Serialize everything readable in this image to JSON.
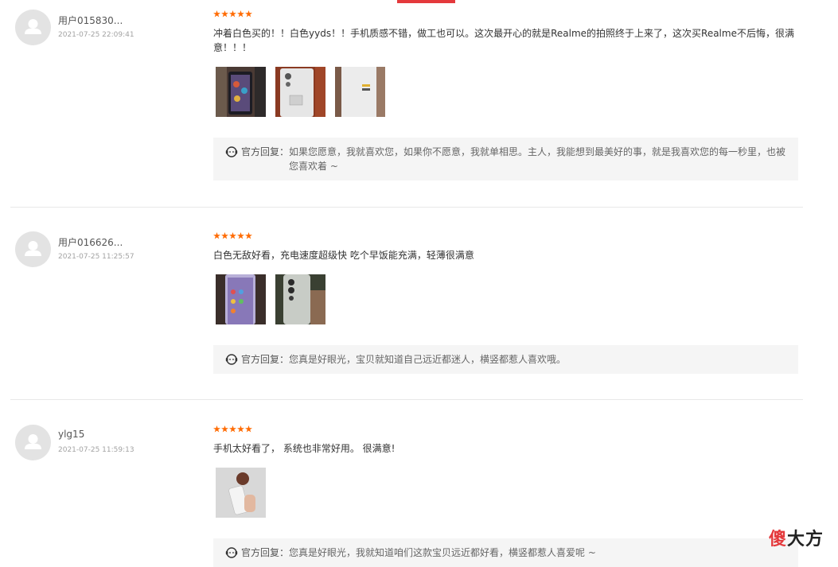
{
  "reviews": [
    {
      "user_name": "用户015830...",
      "date": "2021-07-25 22:09:41",
      "rating": 5,
      "content": "冲着白色买的！！白色yyds！！手机质感不错，做工也可以。这次最开心的就是Realme的拍照终于上来了，这次买Realme不后悔，很满意！！！",
      "reply_label": "官方回复：",
      "reply_text": "如果您愿意，我就喜欢您，如果你不愿意，我就单相思。主人，我能想到最美好的事，就是我喜欢您的每一秒里，也被您喜欢着 ~"
    },
    {
      "user_name": "用户016626...",
      "date": "2021-07-25 11:25:57",
      "rating": 5,
      "content": "白色无敌好看，充电速度超级快 吃个早饭能充满，轻薄很满意",
      "reply_label": "官方回复：",
      "reply_text": "您真是好眼光，宝贝就知道自己远近都迷人，横竖都惹人喜欢哦。"
    },
    {
      "user_name": "ylg15",
      "date": "2021-07-25 11:59:13",
      "rating": 5,
      "content": "手机太好看了， 系统也非常好用。 很满意!",
      "reply_label": "官方回复：",
      "reply_text": "您真是好眼光，我就知道咱们这款宝贝远近都好看，横竖都惹人喜爱呢 ~"
    }
  ],
  "watermark": {
    "accent": "傻",
    "rest": "大方"
  },
  "colors": {
    "star": "#ff6a00",
    "accent": "#e4393c",
    "reply_bg": "#f5f5f5"
  }
}
